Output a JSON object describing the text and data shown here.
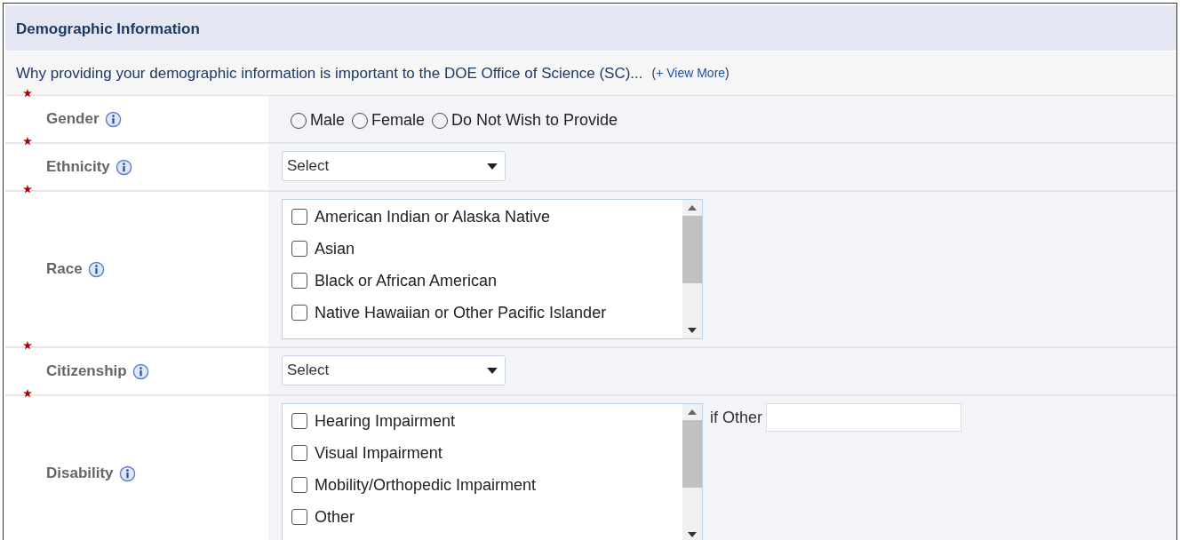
{
  "section": {
    "title": "Demographic Information",
    "intro": "Why providing your demographic information is important to the DOE Office of Science (SC)...",
    "view_more": {
      "open": "(",
      "link": "+ View More",
      "close": ")"
    }
  },
  "fields": [
    {
      "kind": "radio",
      "label": "Gender",
      "required": true,
      "options": [
        {
          "label": "Male",
          "selected": false
        },
        {
          "label": "Female",
          "selected": false
        },
        {
          "label": "Do Not Wish to Provide",
          "selected": false
        }
      ]
    },
    {
      "kind": "select",
      "label": "Ethnicity",
      "required": true,
      "value": "Select"
    },
    {
      "kind": "checklist",
      "label": "Race",
      "required": true,
      "options": [
        {
          "label": "American Indian or Alaska Native",
          "checked": false
        },
        {
          "label": "Asian",
          "checked": false
        },
        {
          "label": "Black or African American",
          "checked": false
        },
        {
          "label": "Native Hawaiian or Other Pacific Islander",
          "checked": false
        }
      ]
    },
    {
      "kind": "select",
      "label": "Citizenship",
      "required": true,
      "value": "Select"
    },
    {
      "kind": "checklist",
      "label": "Disability",
      "required": true,
      "options": [
        {
          "label": "Hearing Impairment",
          "checked": false
        },
        {
          "label": "Visual Impairment",
          "checked": false
        },
        {
          "label": "Mobility/Orthopedic Impairment",
          "checked": false
        },
        {
          "label": "Other",
          "checked": false
        }
      ],
      "other_label": "if Other"
    }
  ]
}
